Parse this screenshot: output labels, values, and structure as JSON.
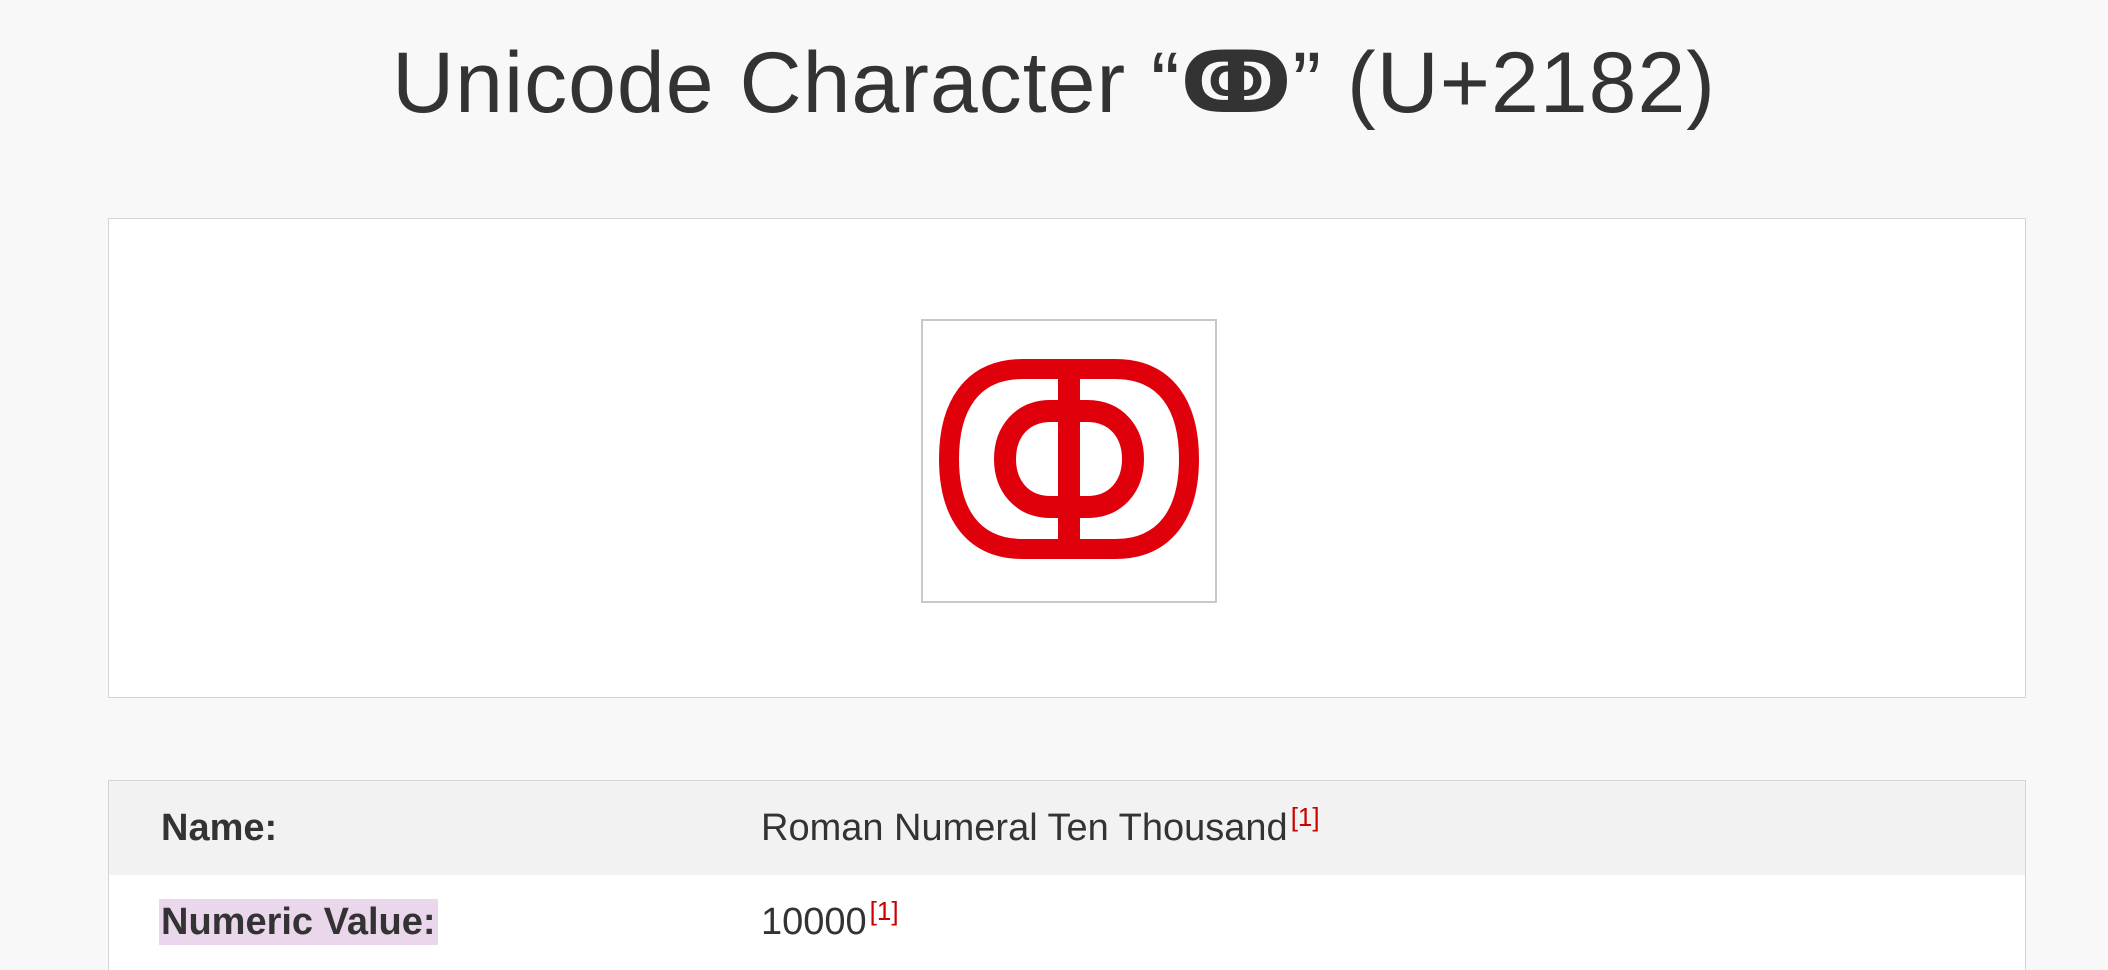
{
  "header": {
    "title_prefix": "Unicode Character “",
    "title_glyph": "ↂ",
    "title_suffix": "” (U+2182)"
  },
  "preview": {
    "glyph_color": "#e0000b",
    "icon": "roman-numeral-ten-thousand-glyph"
  },
  "properties": [
    {
      "label": "Name:",
      "value": "Roman Numeral Ten Thousand",
      "ref": "[1]"
    },
    {
      "label": "Numeric Value:",
      "value": "10000",
      "ref": "[1]"
    }
  ],
  "colors": {
    "reference_link": "#cc0000",
    "highlight": "#ebd7ec"
  }
}
